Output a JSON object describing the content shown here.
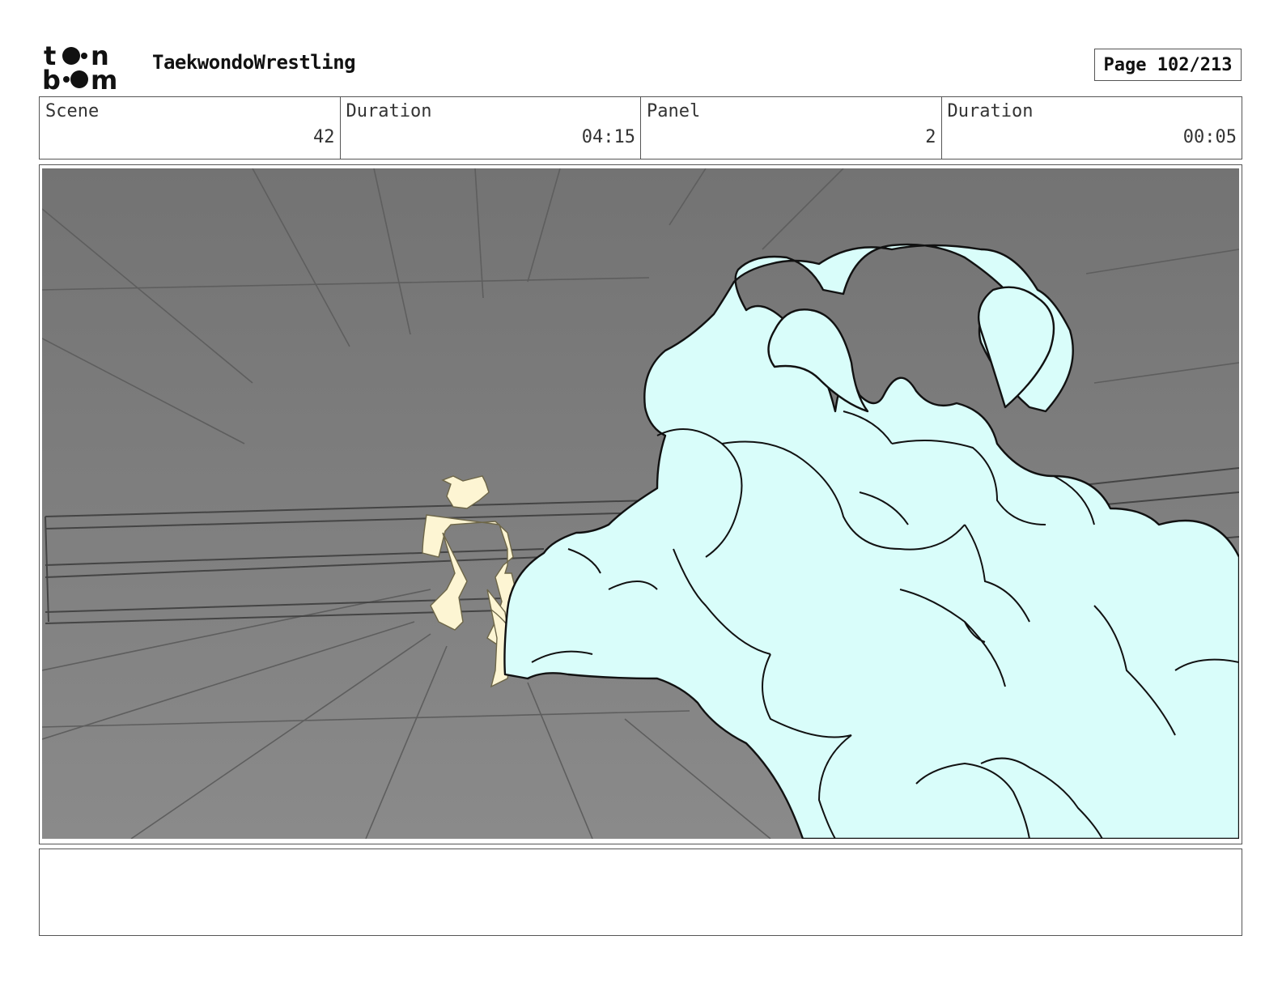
{
  "header": {
    "logo_text": "toon boom",
    "project_title": "TaekwondoWrestling",
    "page_label": "Page 102/213"
  },
  "info": {
    "scene_label": "Scene",
    "scene_value": "42",
    "scene_duration_label": "Duration",
    "scene_duration_value": "04:15",
    "panel_label": "Panel",
    "panel_value": "2",
    "panel_duration_label": "Duration",
    "panel_duration_value": "00:05"
  },
  "colors": {
    "background_gray": "#7a7a7a",
    "creature_fill": "#d9fdfa",
    "fighter_fill": "#fdf5d3",
    "line": "#111111"
  },
  "notes": {
    "text": ""
  }
}
